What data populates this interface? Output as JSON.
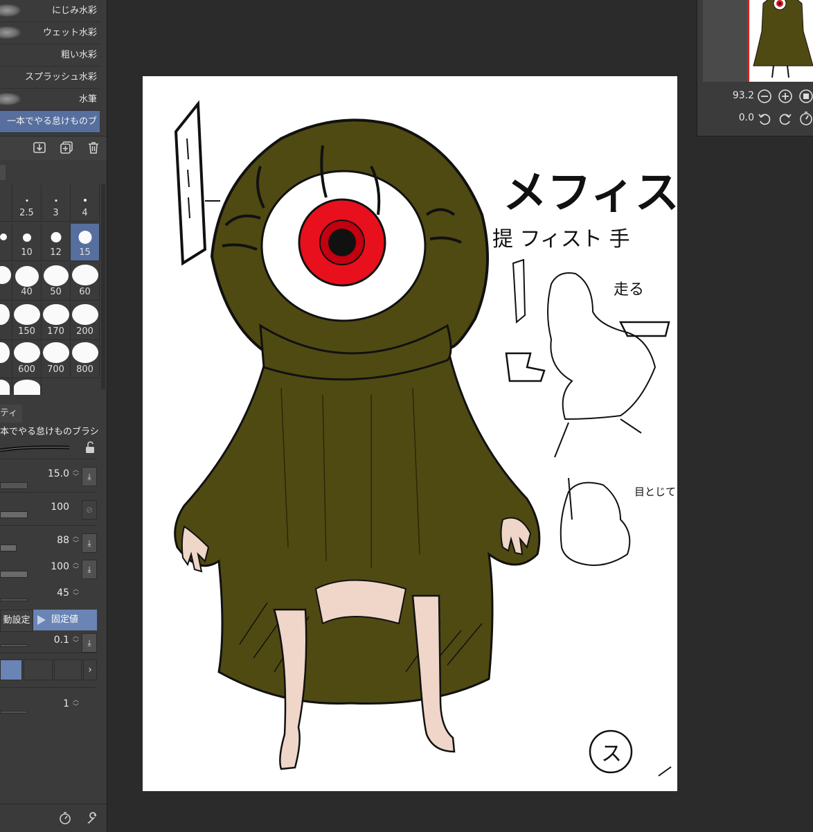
{
  "brush_list": {
    "items": [
      {
        "label": "にじみ水彩",
        "selected": false
      },
      {
        "label": "ウェット水彩",
        "selected": false
      },
      {
        "label": "粗い水彩",
        "selected": false
      },
      {
        "label": "スプラッシュ水彩",
        "selected": false
      },
      {
        "label": "水筆",
        "selected": false
      },
      {
        "label": "一本でやる怠けものブ",
        "selected": true
      }
    ],
    "toolbar_icons": [
      "import-icon",
      "duplicate-icon",
      "trash-icon"
    ]
  },
  "brush_size": {
    "cells": [
      [
        "",
        "",
        "",
        "2.5",
        "3",
        "4"
      ],
      [
        "",
        "10",
        "12",
        "15"
      ],
      [
        "",
        "40",
        "50",
        "60"
      ],
      [
        "",
        "150",
        "170",
        "200"
      ],
      [
        "",
        "600",
        "700",
        "800"
      ]
    ],
    "selected": "15"
  },
  "tool_property": {
    "tab_label": "ティ",
    "brush_name": "本でやる怠けものブラシ",
    "rows": [
      {
        "value": "15.0",
        "has_download": true
      },
      {
        "value": "100",
        "has_download": false
      },
      {
        "value": "88",
        "has_download": true
      },
      {
        "value": "100",
        "has_download": true
      },
      {
        "value": "45",
        "has_download": false
      }
    ],
    "dynamic_label": "動設定",
    "fixed_label": "固定値",
    "row_after": {
      "value": "0.1",
      "has_download": true
    },
    "last_value": "1"
  },
  "navigator": {
    "zoom": "93.2",
    "rotation": "0.0"
  },
  "canvas": {
    "title_text": "メフィスト",
    "subtitle_text": "提 フィスト 手",
    "note_run": "走る",
    "note_close": "目とじて すわる。",
    "signature": "ス",
    "colors": {
      "robe": "#4f4a12",
      "eye_red": "#e8101c",
      "skin": "#efd6c8"
    }
  }
}
